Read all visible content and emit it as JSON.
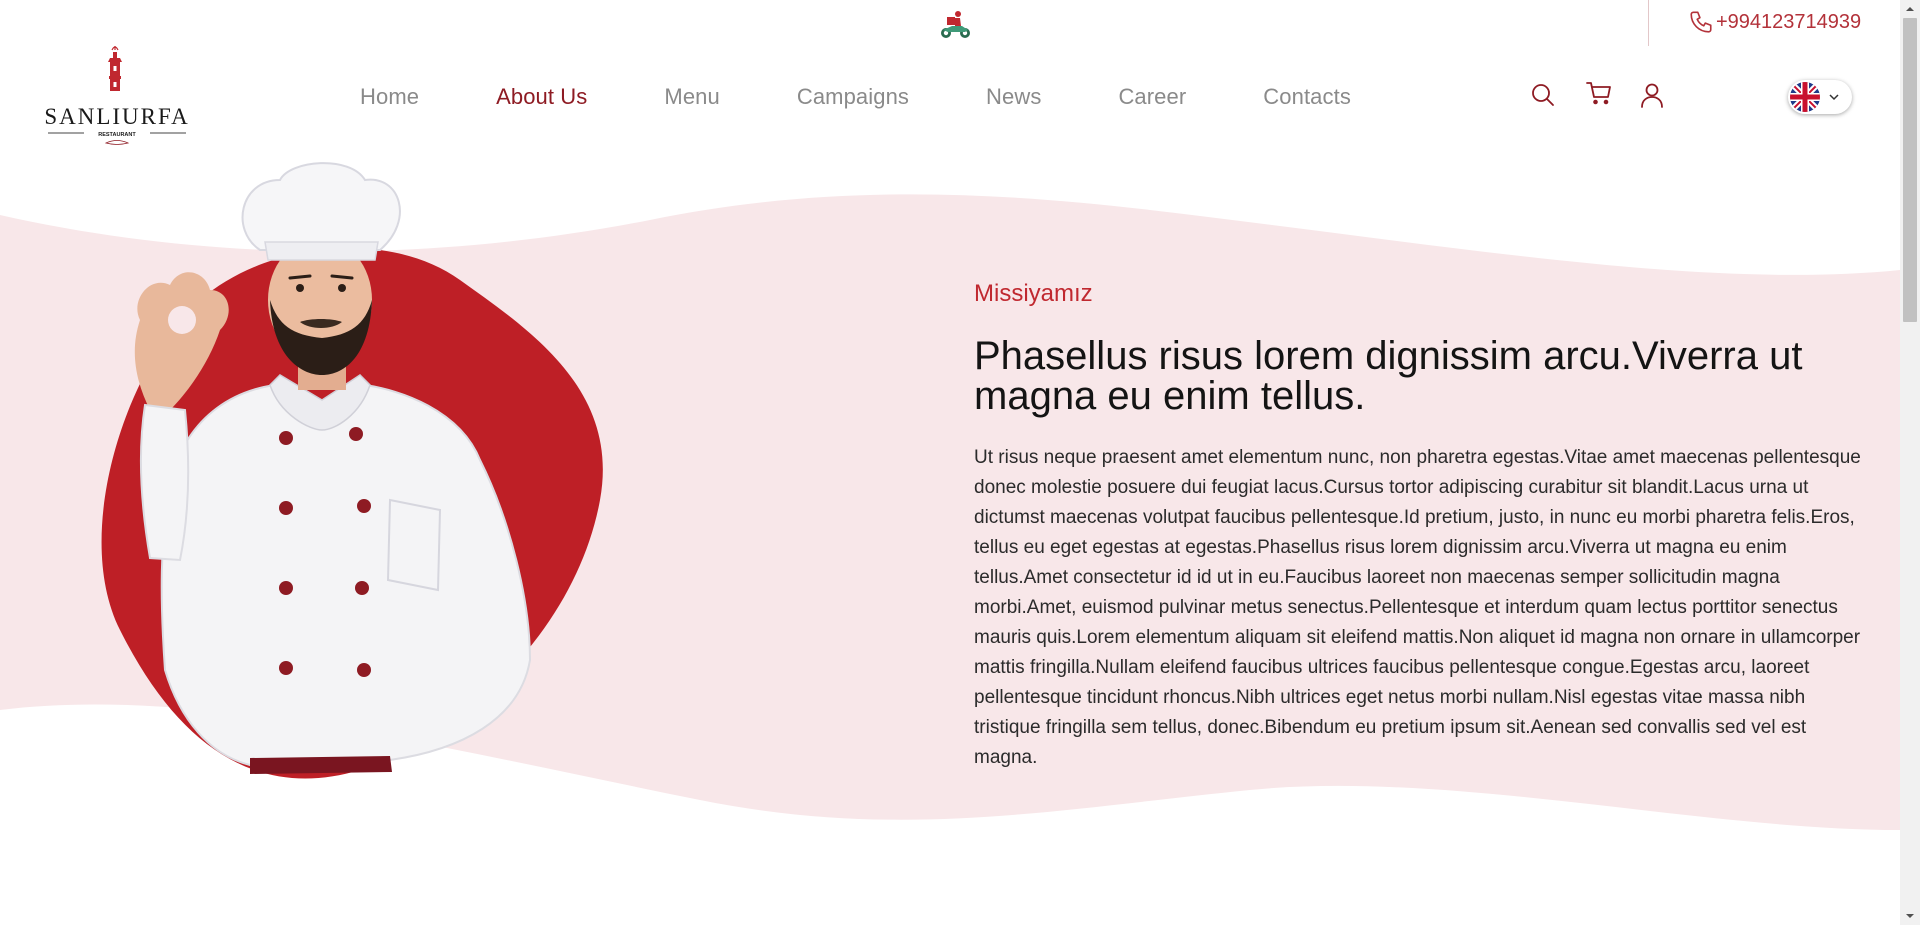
{
  "topbar": {
    "phone": "+994123714939",
    "delivery_icon": "delivery-scooter-icon",
    "phone_icon": "phone-icon"
  },
  "header": {
    "logo": {
      "name": "SANLIURFA",
      "tagline": "RESTAURANT"
    },
    "nav": [
      {
        "label": "Home",
        "active": false
      },
      {
        "label": "About Us",
        "active": true
      },
      {
        "label": "Menu",
        "active": false
      },
      {
        "label": "Campaigns",
        "active": false
      },
      {
        "label": "News",
        "active": false
      },
      {
        "label": "Career",
        "active": false
      },
      {
        "label": "Contacts",
        "active": false
      }
    ],
    "icons": [
      "search-icon",
      "cart-icon",
      "user-icon"
    ],
    "language": {
      "flag": "uk-flag-icon",
      "chevron": "chevron-down-icon"
    }
  },
  "hero": {
    "eyebrow": "Missiyamız",
    "headline": "Phasellus risus lorem dignissim arcu.Viverra ut magna eu enim tellus.",
    "body": "Ut risus neque praesent amet elementum nunc, non pharetra egestas.Vitae amet maecenas pellentesque donec molestie posuere dui feugiat lacus.Cursus tortor adipiscing curabitur sit blandit.Lacus urna ut dictumst maecenas volutpat faucibus pellentesque.Id pretium, justo, in nunc eu morbi pharetra felis.Eros, tellus eu eget egestas at egestas.Phasellus risus lorem dignissim arcu.Viverra ut magna eu enim tellus.Amet consectetur id id ut in eu.Faucibus laoreet non maecenas semper sollicitudin magna morbi.Amet, euismod pulvinar metus senectus.Pellentesque et interdum quam lectus porttitor senectus mauris quis.Lorem elementum aliquam sit eleifend mattis.Non aliquet id magna non ornare in ullamcorper mattis fringilla.Nullam eleifend faucibus ultrices faucibus pellentesque congue.Egestas arcu, laoreet pellentesque tincidunt rhoncus.Nibh ultrices eget netus morbi nullam.Nisl egestas vitae massa nibh tristique fringilla sem tellus, donec.Bibendum eu pretium ipsum sit.Aenean sed convallis sed vel est magna.",
    "image": "chef-ok-gesture-image"
  },
  "colors": {
    "brand": "#8e1b23",
    "accent": "#c0282f",
    "nav_inactive": "#8a8a8a",
    "wave_bg": "#f8e7e9",
    "blob": "#be1f26"
  }
}
